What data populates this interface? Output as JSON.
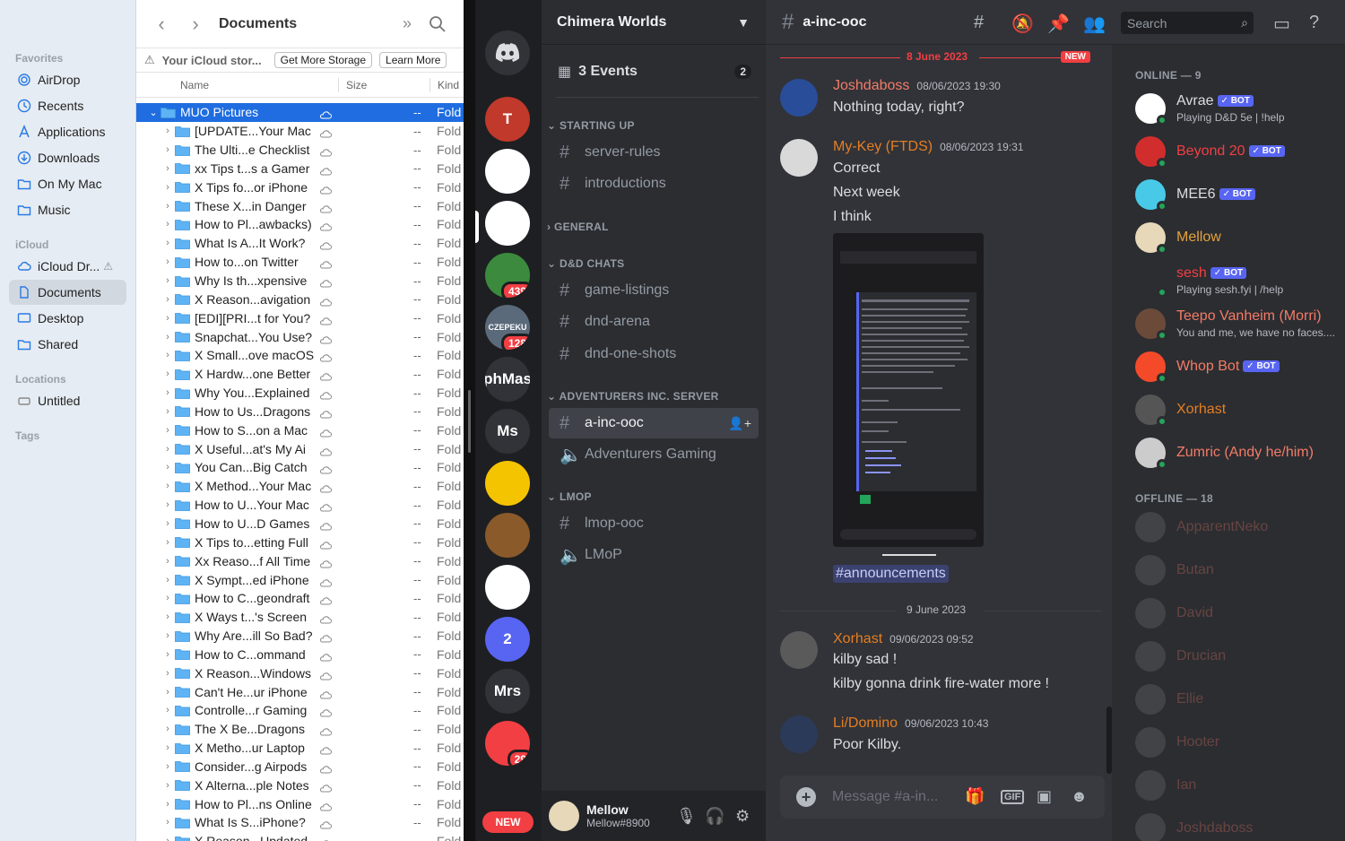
{
  "finder": {
    "sidebar": {
      "favorites_label": "Favorites",
      "favorites": [
        "AirDrop",
        "Recents",
        "Applications",
        "Downloads",
        "On My Mac",
        "Music"
      ],
      "icloud_label": "iCloud",
      "icloud": [
        "iCloud Dr...",
        "Documents",
        "Desktop",
        "Shared"
      ],
      "locations_label": "Locations",
      "locations": [
        "Untitled"
      ],
      "tags_label": "Tags"
    },
    "toolbar": {
      "title": "Documents"
    },
    "icloud_bar": {
      "text": "Your iCloud stor...",
      "btn1": "Get More Storage",
      "btn2": "Learn More"
    },
    "columns": {
      "name": "Name",
      "size": "Size",
      "kind": "Kind"
    },
    "selected_folder": "MUO Pictures",
    "size_value": "--",
    "kind_value": "Fold",
    "files": [
      "[UPDATE...Your Mac",
      "The Ulti...e Checklist",
      "xx Tips t...s a Gamer",
      "X Tips fo...or iPhone",
      "These X...in Danger",
      "How to Pl...awbacks)",
      "What Is A...It Work?",
      "How to...on Twitter",
      "Why Is th...xpensive",
      "X Reason...avigation",
      "[EDI][PRI...t for You?",
      "Snapchat...You Use?",
      "X Small...ove macOS",
      "X Hardw...one Better",
      "Why You...Explained",
      "How to Us...Dragons",
      "How to S...on a Mac",
      "X Useful...at's My Ai",
      "You Can...Big Catch",
      "X Method...Your Mac",
      "How to U...Your Mac",
      "How to U...D Games",
      "X Tips to...etting Full",
      "Xx Reaso...f All Time",
      "X Sympt...ed iPhone",
      "How to C...geondraft",
      "X Ways t...'s Screen",
      "Why Are...ill So Bad?",
      "How to C...ommand",
      "X Reason...Windows",
      "Can't He...ur iPhone",
      "Controlle...r Gaming",
      "The X Be...Dragons",
      "X Metho...ur Laptop",
      "Consider...g Airpods",
      "X Alterna...ple Notes",
      "How to Pl...ns Online",
      "What Is S...iPhone?",
      "X Reason...Updated"
    ]
  },
  "discord": {
    "servers": [
      {
        "label": "T",
        "color": "#c0392b"
      },
      {
        "label": "",
        "color": "#ffffff"
      },
      {
        "label": "",
        "color": "#ffffff"
      },
      {
        "label": "",
        "color": "#3b8a3e",
        "badge": "439"
      },
      {
        "label": "CZEPEKU",
        "color": "#5a6a7a",
        "badge": "128"
      },
      {
        "label": "phMas",
        "color": "#313338"
      },
      {
        "label": "Ms",
        "color": "#313338"
      },
      {
        "label": "",
        "color": "#f5c400"
      },
      {
        "label": "",
        "color": "#8a5a2a"
      },
      {
        "label": "",
        "color": "#ffffff"
      },
      {
        "label": "2",
        "color": "#5865f2"
      },
      {
        "label": "Mrs",
        "color": "#313338"
      },
      {
        "label": "",
        "color": "#f23f43",
        "badge": "29"
      }
    ],
    "new_pill": "NEW",
    "guild_name": "Chimera Worlds",
    "events_label": "3 Events",
    "events_count": "2",
    "categories": {
      "starting_up": "STARTING UP",
      "general": "GENERAL",
      "dnd_chats": "D&D CHATS",
      "adventurers": "ADVENTURERS INC. SERVER",
      "lmop": "LMOP"
    },
    "channels": {
      "server_rules": "server-rules",
      "introductions": "introductions",
      "game_listings": "game-listings",
      "dnd_arena": "dnd-arena",
      "dnd_one_shots": "dnd-one-shots",
      "a_inc_ooc": "a-inc-ooc",
      "adventurers_gaming": "Adventurers Gaming",
      "lmop_ooc": "lmop-ooc",
      "lmop_voice": "LMoP"
    },
    "user": {
      "name": "Mellow",
      "tag": "Mellow#8900"
    },
    "chat": {
      "channel": "a-inc-ooc",
      "search_placeholder": "Search",
      "date1": "8 June 2023",
      "new_label": "NEW",
      "date2": "9 June 2023",
      "messages": [
        {
          "author": "Joshdaboss",
          "color": "#f47b67",
          "time": "08/06/2023 19:30",
          "lines": [
            "Nothing today, right?"
          ]
        },
        {
          "author": "My-Key (FTDS)",
          "color": "#e67e22",
          "time": "08/06/2023 19:31",
          "lines": [
            "Correct",
            "Next week",
            "I think"
          ]
        },
        {
          "author": "Xorhast",
          "color": "#e67e22",
          "time": "09/06/2023 09:52",
          "lines": [
            "kilby sad !",
            "kilby gonna drink fire-water more !"
          ]
        },
        {
          "author": "Li/Domino",
          "color": "#e67e22",
          "time": "09/06/2023 10:43",
          "lines": [
            "Poor Kilby."
          ]
        }
      ],
      "mention": "#announcements",
      "composer_placeholder": "Message #a-in..."
    },
    "members": {
      "online_label": "ONLINE — 9",
      "offline_label": "OFFLINE — 18",
      "bot_label": "BOT",
      "online": [
        {
          "name": "Avrae",
          "color": "#dbdee1",
          "bot": true,
          "status": "Playing D&D 5e | !help"
        },
        {
          "name": "Beyond 20",
          "color": "#f23f43",
          "bot": true,
          "status": ""
        },
        {
          "name": "MEE6",
          "color": "#dbdee1",
          "bot": true,
          "status": ""
        },
        {
          "name": "Mellow",
          "color": "#e6a23c",
          "bot": false,
          "status": ""
        },
        {
          "name": "sesh",
          "color": "#f23f43",
          "bot": true,
          "status": "Playing sesh.fyi | /help"
        },
        {
          "name": "Teepo Vanheim (Morri)",
          "color": "#f47b67",
          "bot": false,
          "status": "You and me, we have no faces...."
        },
        {
          "name": "Whop Bot",
          "color": "#f47b67",
          "bot": true,
          "status": ""
        },
        {
          "name": "Xorhast",
          "color": "#e67e22",
          "bot": false,
          "status": ""
        },
        {
          "name": "Zumric (Andy he/him)",
          "color": "#f47b67",
          "bot": false,
          "status": ""
        }
      ],
      "offline": [
        "ApparentNeko",
        "Butan",
        "David",
        "Drucian",
        "Ellie",
        "Hooter",
        "Ian",
        "Joshdaboss"
      ]
    }
  }
}
